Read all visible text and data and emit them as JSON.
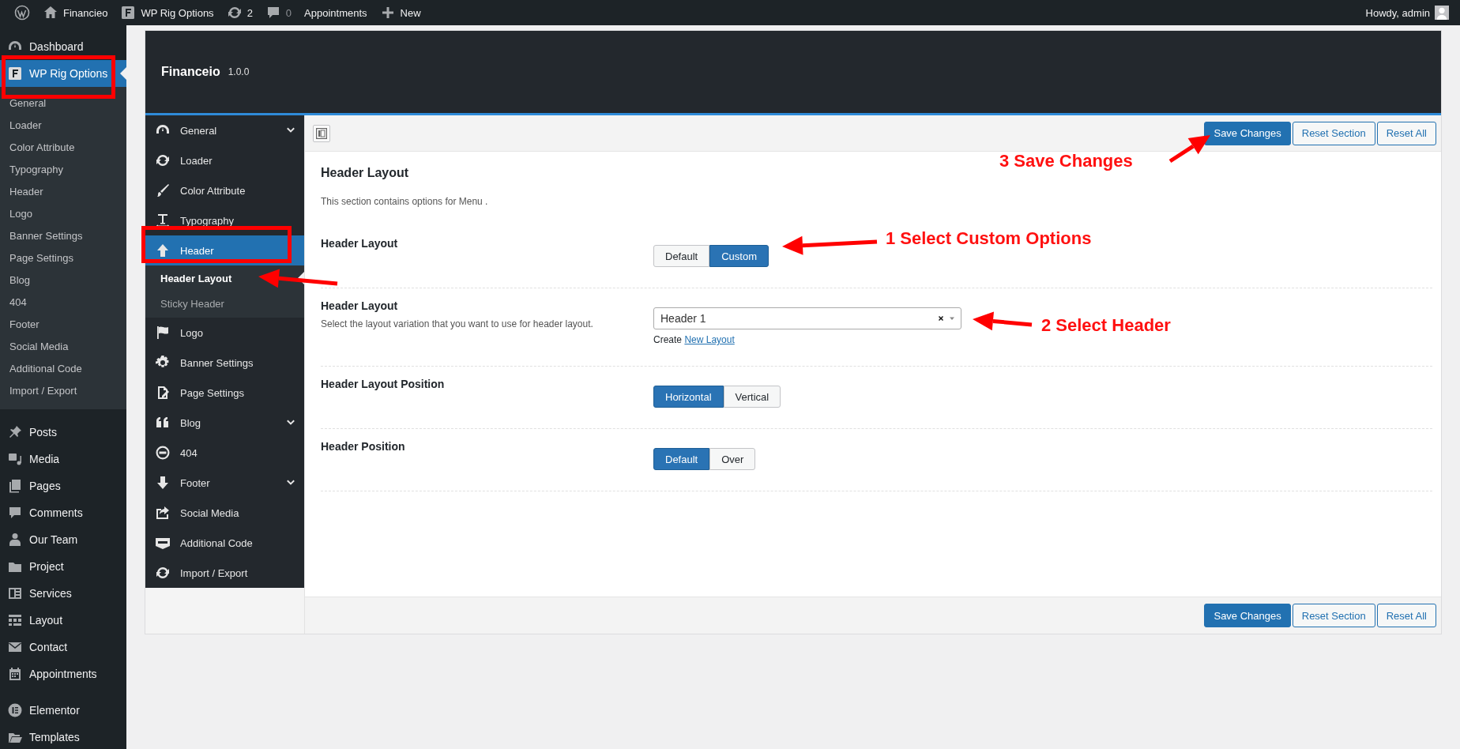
{
  "admin_bar": {
    "items": [
      {
        "kind": "wp"
      },
      {
        "kind": "site",
        "label": "Financieo"
      },
      {
        "kind": "options",
        "label": "WP Rig Options"
      },
      {
        "kind": "updates",
        "label": "2"
      },
      {
        "kind": "comments",
        "label": "0"
      },
      {
        "kind": "text",
        "label": "Appointments"
      },
      {
        "kind": "new",
        "label": "New"
      }
    ],
    "account": "Howdy, admin"
  },
  "sidebar": {
    "sections": [
      {
        "items": [
          {
            "label": "Dashboard",
            "selected": false
          },
          {
            "label": "WP Rig Options",
            "selected": true,
            "children": [
              {
                "label": "General",
                "selected": false
              },
              {
                "label": "Loader",
                "selected": false
              },
              {
                "label": "Color Attribute",
                "selected": false
              },
              {
                "label": "Typography",
                "selected": false
              },
              {
                "label": "Header",
                "selected": false
              },
              {
                "label": "Logo",
                "selected": false
              },
              {
                "label": "Banner Settings",
                "selected": false
              },
              {
                "label": "Page Settings",
                "selected": false
              },
              {
                "label": "Blog",
                "selected": false
              },
              {
                "label": "404",
                "selected": false
              },
              {
                "label": "Footer",
                "selected": false
              },
              {
                "label": "Social Media",
                "selected": false
              },
              {
                "label": "Additional Code",
                "selected": false
              },
              {
                "label": "Import / Export",
                "selected": false
              }
            ]
          }
        ]
      },
      {
        "items": [
          {
            "label": "Posts",
            "selected": false
          },
          {
            "label": "Media",
            "selected": false
          },
          {
            "label": "Pages",
            "selected": false
          },
          {
            "label": "Comments",
            "selected": false
          },
          {
            "label": "Our Team",
            "selected": false
          },
          {
            "label": "Project",
            "selected": false
          },
          {
            "label": "Services",
            "selected": false
          },
          {
            "label": "Layout",
            "selected": false
          },
          {
            "label": "Contact",
            "selected": false
          },
          {
            "label": "Appointments",
            "selected": false
          }
        ]
      },
      {
        "items": [
          {
            "label": "Elementor",
            "selected": false
          },
          {
            "label": "Templates",
            "selected": false
          }
        ]
      }
    ]
  },
  "panel": {
    "title": "Financeio",
    "version": "1.0.0"
  },
  "options_menu": {
    "items": [
      {
        "label": "General",
        "selected": false,
        "expanded": false
      },
      {
        "label": "Loader",
        "selected": false
      },
      {
        "label": "Color Attribute",
        "selected": false
      },
      {
        "label": "Typography",
        "selected": false
      },
      {
        "label": "Header",
        "selected": true,
        "expanded": true,
        "children": [
          {
            "label": "Header Layout",
            "selected": true
          },
          {
            "label": "Sticky Header",
            "selected": false
          }
        ]
      },
      {
        "label": "Logo",
        "selected": false
      },
      {
        "label": "Banner Settings",
        "selected": false
      },
      {
        "label": "Page Settings",
        "selected": false
      },
      {
        "label": "Blog",
        "selected": false,
        "expanded": false
      },
      {
        "label": "404",
        "selected": false
      },
      {
        "label": "Footer",
        "selected": false,
        "expanded": false
      },
      {
        "label": "Social Media",
        "selected": false
      },
      {
        "label": "Additional Code",
        "selected": false
      },
      {
        "label": "Import / Export",
        "selected": false
      }
    ]
  },
  "toolbar": {
    "buttons": [
      {
        "label": "Save Changes",
        "kind": "primary"
      },
      {
        "label": "Reset Section",
        "kind": "secondary"
      },
      {
        "label": "Reset All",
        "kind": "secondary"
      }
    ]
  },
  "section": {
    "title": "Header Layout",
    "description": "This section contains options for Menu ."
  },
  "fields": [
    {
      "kind": "button_set",
      "label": "Header Layout",
      "options": [
        {
          "label": "Default",
          "selected": false
        },
        {
          "label": "Custom",
          "selected": true
        }
      ]
    },
    {
      "kind": "select",
      "label": "Header Layout",
      "description": "Select the layout variation that you want to use for header layout.",
      "value": "Header 1",
      "link_prefix": "Create",
      "link": "New Layout"
    },
    {
      "kind": "button_set",
      "label": "Header Layout Position",
      "options": [
        {
          "label": "Horizontal",
          "selected": true
        },
        {
          "label": "Vertical",
          "selected": false
        }
      ]
    },
    {
      "kind": "button_set",
      "label": "Header Position",
      "options": [
        {
          "label": "Default",
          "selected": true
        },
        {
          "label": "Over",
          "selected": false
        }
      ]
    }
  ],
  "footer": {
    "buttons": [
      {
        "label": "Save Changes",
        "kind": "primary"
      },
      {
        "label": "Reset Section",
        "kind": "secondary"
      },
      {
        "label": "Reset All",
        "kind": "secondary"
      }
    ]
  },
  "annotations": [
    {
      "text": "1 Select Custom Options"
    },
    {
      "text": "2 Select Header"
    },
    {
      "text": "3 Save Changes"
    }
  ]
}
